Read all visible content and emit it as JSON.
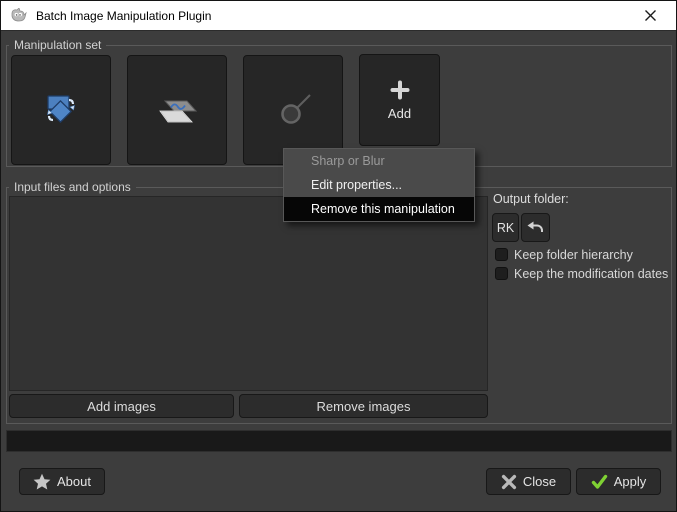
{
  "window": {
    "title": "Batch Image Manipulation Plugin"
  },
  "manipulation_set": {
    "label": "Manipulation set",
    "buttons": [
      {
        "name": "rotate"
      },
      {
        "name": "curves"
      },
      {
        "name": "sharp-or-blur"
      },
      {
        "name": "add",
        "label": "Add"
      }
    ]
  },
  "context_menu": {
    "header": "Sharp or Blur",
    "items": [
      {
        "label": "Edit properties...",
        "highlighted": false
      },
      {
        "label": "Remove this manipulation",
        "highlighted": true
      }
    ]
  },
  "input_files": {
    "label": "Input files and options",
    "add_images_label": "Add images",
    "remove_images_label": "Remove images"
  },
  "output": {
    "label": "Output folder:",
    "folder_button_label": "RK",
    "options": [
      {
        "label": "Keep folder hierarchy",
        "checked": false
      },
      {
        "label": "Keep the modification dates",
        "checked": false
      }
    ]
  },
  "footer": {
    "about_label": "About",
    "close_label": "Close",
    "apply_label": "Apply"
  },
  "colors": {
    "titlebar_bg": "#ffffff",
    "body_bg": "#3d3d3d",
    "menu_highlight": "#060606",
    "accent_green": "#7fd133",
    "icon_blue": "#4c80bf"
  }
}
